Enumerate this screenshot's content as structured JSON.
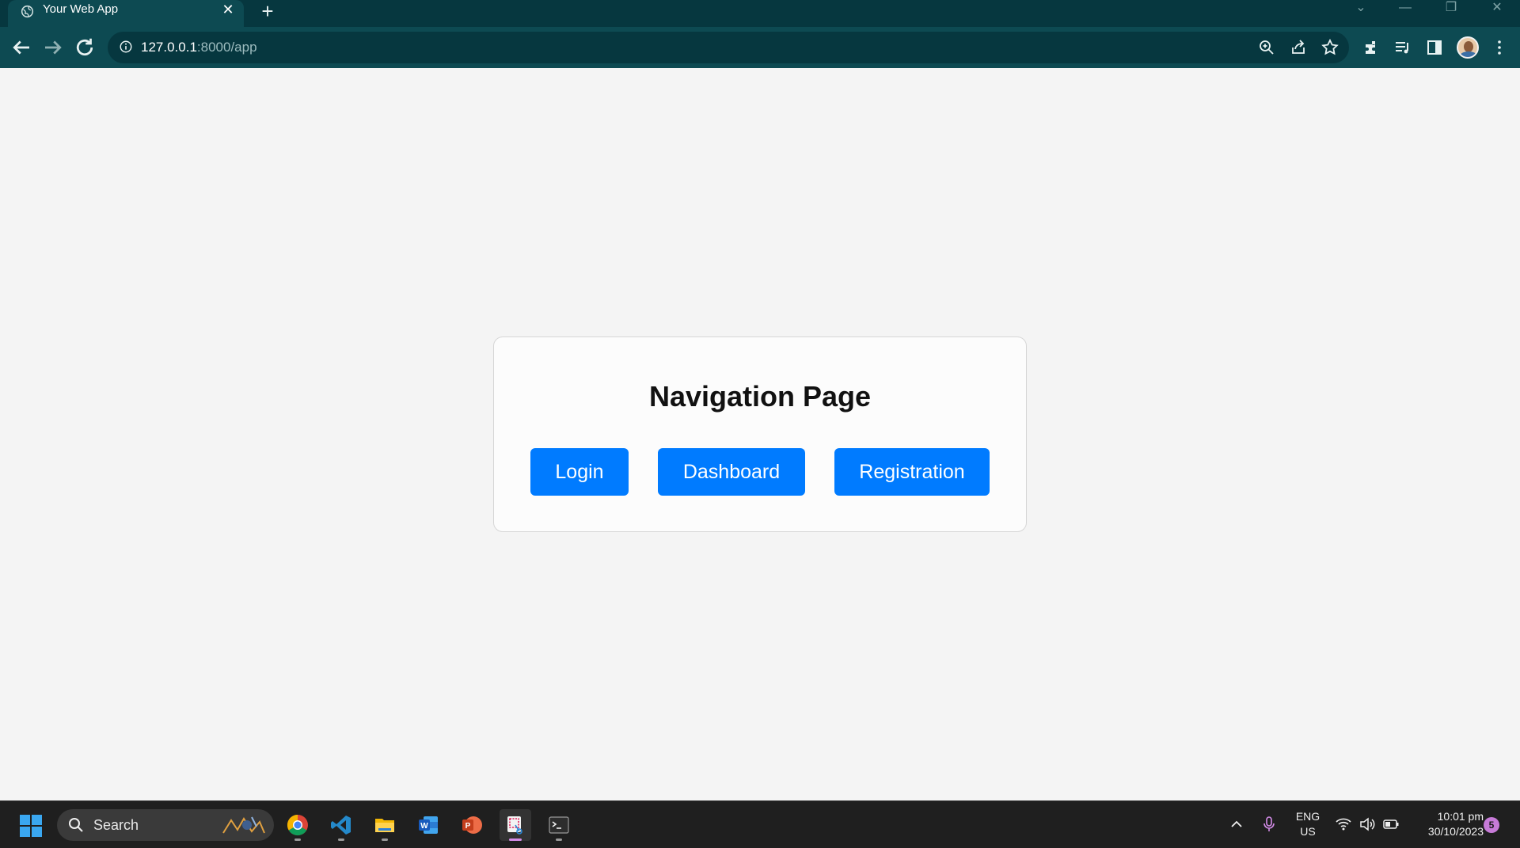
{
  "browser": {
    "tab": {
      "title": "Your Web App",
      "close_glyph": "✕"
    },
    "new_tab_glyph": "+",
    "window_controls": [
      "⌄",
      "—",
      "❐",
      "✕"
    ],
    "address": {
      "host": "127.0.0.1",
      "path": ":8000/app"
    },
    "icons": [
      "back-icon",
      "forward-icon",
      "reload-icon",
      "info-icon",
      "zoom-icon",
      "share-icon",
      "star-icon",
      "extensions-icon",
      "media-icon",
      "sidepanel-icon",
      "avatar",
      "menu-icon"
    ]
  },
  "page": {
    "heading": "Navigation Page",
    "buttons": {
      "login": "Login",
      "dashboard": "Dashboard",
      "registration": "Registration"
    },
    "button_color": "#007bff"
  },
  "taskbar": {
    "search_label": "Search",
    "apps": [
      "chrome",
      "vscode",
      "file-explorer",
      "word",
      "powerpoint",
      "snipping-tool",
      "terminal"
    ],
    "active_app": "snipping-tool",
    "language": {
      "line1": "ENG",
      "line2": "US"
    },
    "clock": {
      "time": "10:01 pm",
      "date": "30/10/2023"
    },
    "notification_count": "5"
  }
}
